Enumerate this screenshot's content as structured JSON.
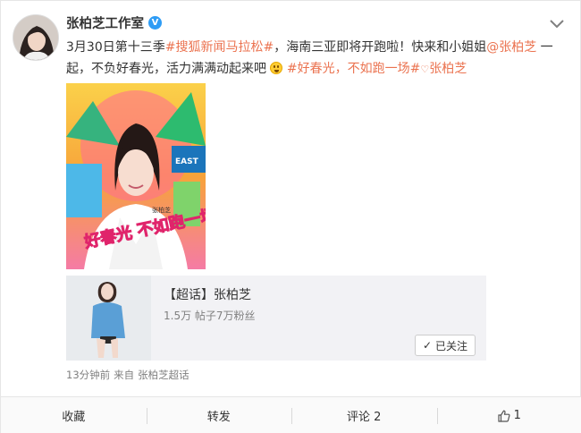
{
  "post": {
    "author": "张柏芝工作室",
    "verified_badge": "V",
    "text_segments": [
      {
        "text": "3月30日第十三季",
        "type": "plain"
      },
      {
        "text": "#搜狐新闻马拉松#",
        "type": "topic"
      },
      {
        "text": "，海南三亚即将开跑啦！快来和小姐姐",
        "type": "plain"
      },
      {
        "text": "@张柏芝",
        "type": "mention"
      },
      {
        "text": " 一起，不负好春光，活力满满动起来吧",
        "type": "plain"
      },
      {
        "text": "#好春光，不如跑一场",
        "type": "topic"
      },
      {
        "text": "#",
        "type": "topic"
      },
      {
        "text": "张柏芝",
        "type": "topic"
      }
    ],
    "poster_text": "好春光 不如跑一场",
    "poster_badge": "EAST",
    "poster_corner": "张柏芝"
  },
  "chaohua": {
    "title": "【超话】张柏芝",
    "stats": "1.5万 帖子7万粉丝",
    "follow_label": "已关注",
    "follow_check": "✓"
  },
  "meta": {
    "time": "13分钟前",
    "source_prefix": "来自",
    "source": "张柏芝超话"
  },
  "actions": {
    "favorite": "收藏",
    "repost": "转发",
    "comment": "评论 2",
    "like_count": "1"
  },
  "colors": {
    "link": "#eb7350",
    "verified": "#2e9cf5"
  }
}
